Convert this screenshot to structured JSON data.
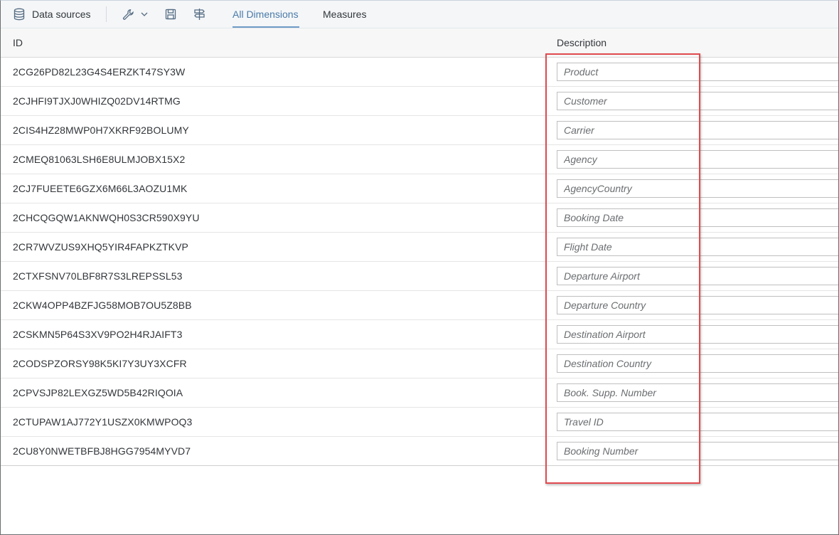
{
  "toolbar": {
    "data_sources_label": "Data sources",
    "tabs": [
      {
        "label": "All Dimensions",
        "active": true
      },
      {
        "label": "Measures",
        "active": false
      }
    ],
    "icons": [
      "database-icon",
      "wrench-icon",
      "chevron-down-icon",
      "save-icon",
      "signpost-icon"
    ]
  },
  "table": {
    "columns": [
      "ID",
      "Description"
    ],
    "rows": [
      {
        "id": "2CG26PD82L23G4S4ERZKT47SY3W",
        "description": "Product"
      },
      {
        "id": "2CJHFI9TJXJ0WHIZQ02DV14RTMG",
        "description": "Customer"
      },
      {
        "id": "2CIS4HZ28MWP0H7XKRF92BOLUMY",
        "description": "Carrier"
      },
      {
        "id": "2CMEQ81063LSH6E8ULMJOBX15X2",
        "description": "Agency"
      },
      {
        "id": "2CJ7FUEETE6GZX6M66L3AOZU1MK",
        "description": "AgencyCountry"
      },
      {
        "id": "2CHCQGQW1AKNWQH0S3CR590X9YU",
        "description": "Booking Date"
      },
      {
        "id": "2CR7WVZUS9XHQ5YIR4FAPKZTKVP",
        "description": "Flight Date"
      },
      {
        "id": "2CTXFSNV70LBF8R7S3LREPSSL53",
        "description": "Departure Airport"
      },
      {
        "id": "2CKW4OPP4BZFJG58MOB7OU5Z8BB",
        "description": "Departure Country"
      },
      {
        "id": "2CSKMN5P64S3XV9PO2H4RJAIFT3",
        "description": "Destination Airport"
      },
      {
        "id": "2CODSPZORSY98K5KI7Y3UY3XCFR",
        "description": "Destination Country"
      },
      {
        "id": "2CPVSJP82LEXGZ5WD5B42RIQOIA",
        "description": "Book. Supp. Number"
      },
      {
        "id": "2CTUPAW1AJ772Y1USZX0KMWPOQ3",
        "description": "Travel ID"
      },
      {
        "id": "2CU8Y0NWETBFBJ8HGG7954MYVD7",
        "description": "Booking Number"
      }
    ]
  },
  "colors": {
    "accent": "#4a7aa8",
    "highlight_border": "#e04a4f",
    "toolbar_bg": "#f4f6f8",
    "header_bg": "#f7f7f7"
  }
}
